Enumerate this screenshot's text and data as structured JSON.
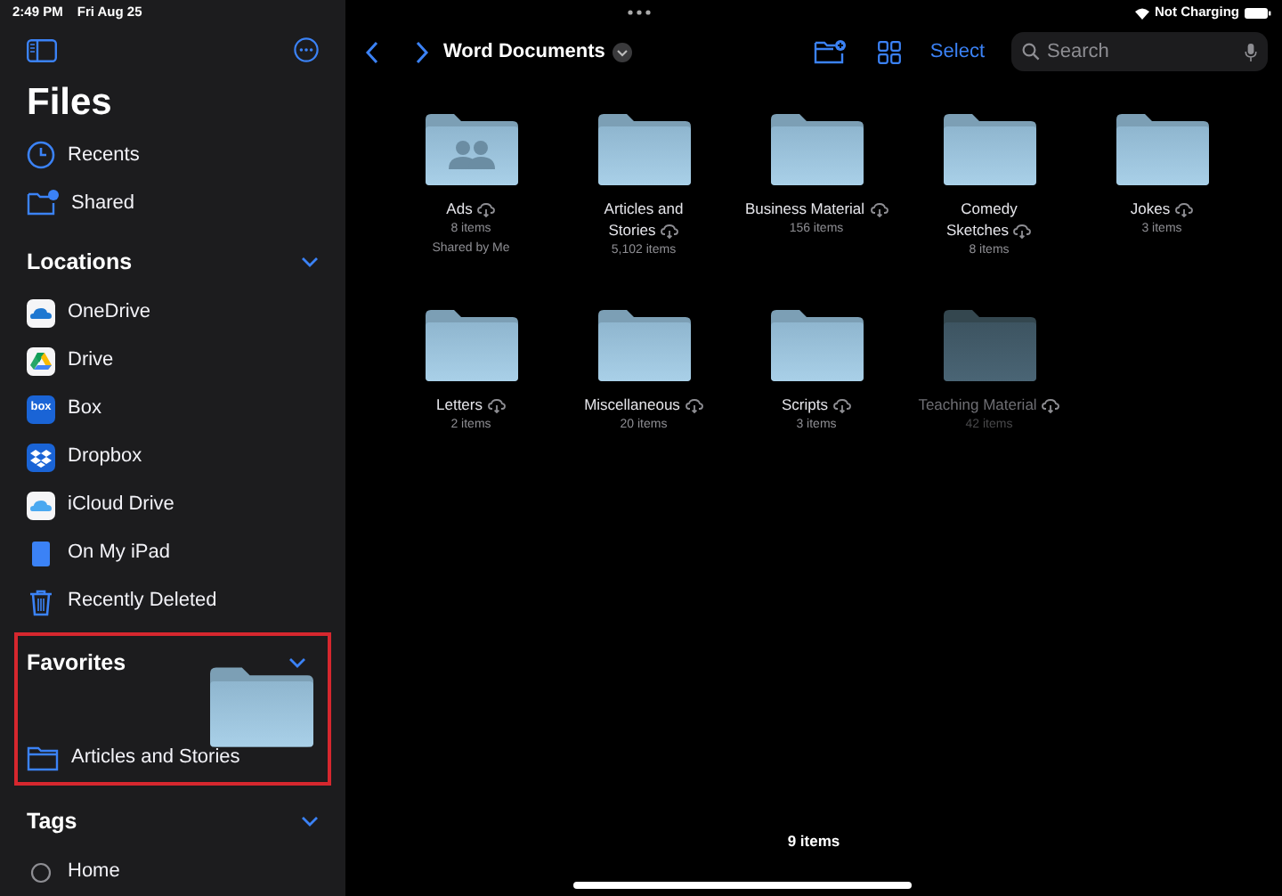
{
  "status_bar": {
    "time": "2:49 PM",
    "date": "Fri Aug 25",
    "battery_text": "Not Charging"
  },
  "sidebar": {
    "title": "Files",
    "top_items": [
      {
        "kind": "clock",
        "label": "Recents"
      },
      {
        "kind": "shared",
        "label": "Shared"
      }
    ],
    "sections": [
      {
        "title": "Locations",
        "expanded": true,
        "highlighted": false,
        "items": [
          {
            "kind": "onedrive",
            "label": "OneDrive"
          },
          {
            "kind": "drive",
            "label": "Drive"
          },
          {
            "kind": "box",
            "label": "Box",
            "icon_text": "box"
          },
          {
            "kind": "dropbox",
            "label": "Dropbox"
          },
          {
            "kind": "icloud",
            "label": "iCloud Drive"
          },
          {
            "kind": "ipad",
            "label": "On My iPad"
          },
          {
            "kind": "trash",
            "label": "Recently Deleted"
          }
        ]
      },
      {
        "title": "Favorites",
        "expanded": true,
        "highlighted": true,
        "dragging": true,
        "items": [
          {
            "kind": "folder",
            "label": "Articles and Stories"
          }
        ]
      },
      {
        "title": "Tags",
        "expanded": true,
        "highlighted": false,
        "items": [
          {
            "kind": "tag",
            "label": "Home"
          }
        ]
      }
    ]
  },
  "toolbar": {
    "title": "Word Documents",
    "select_label": "Select",
    "search": {
      "placeholder": "Search"
    }
  },
  "folders": [
    {
      "name": "Ads",
      "count": "8 items",
      "note": "Shared by Me",
      "shared": true,
      "dimmed": false
    },
    {
      "name": "Articles and\nStories",
      "count": "5,102 items",
      "shared": false,
      "dimmed": false
    },
    {
      "name": "Business Material",
      "count": "156 items",
      "shared": false,
      "dimmed": false
    },
    {
      "name": "Comedy\nSketches",
      "count": "8 items",
      "shared": false,
      "dimmed": false
    },
    {
      "name": "Jokes",
      "count": "3 items",
      "shared": false,
      "dimmed": false
    },
    {
      "name": "Letters",
      "count": "2 items",
      "shared": false,
      "dimmed": false
    },
    {
      "name": "Miscellaneous",
      "count": "20 items",
      "shared": false,
      "dimmed": false
    },
    {
      "name": "Scripts",
      "count": "3 items",
      "shared": false,
      "dimmed": false
    },
    {
      "name": "Teaching Material",
      "count": "42 items",
      "shared": false,
      "dimmed": true
    }
  ],
  "footer": {
    "count": "9 items"
  }
}
